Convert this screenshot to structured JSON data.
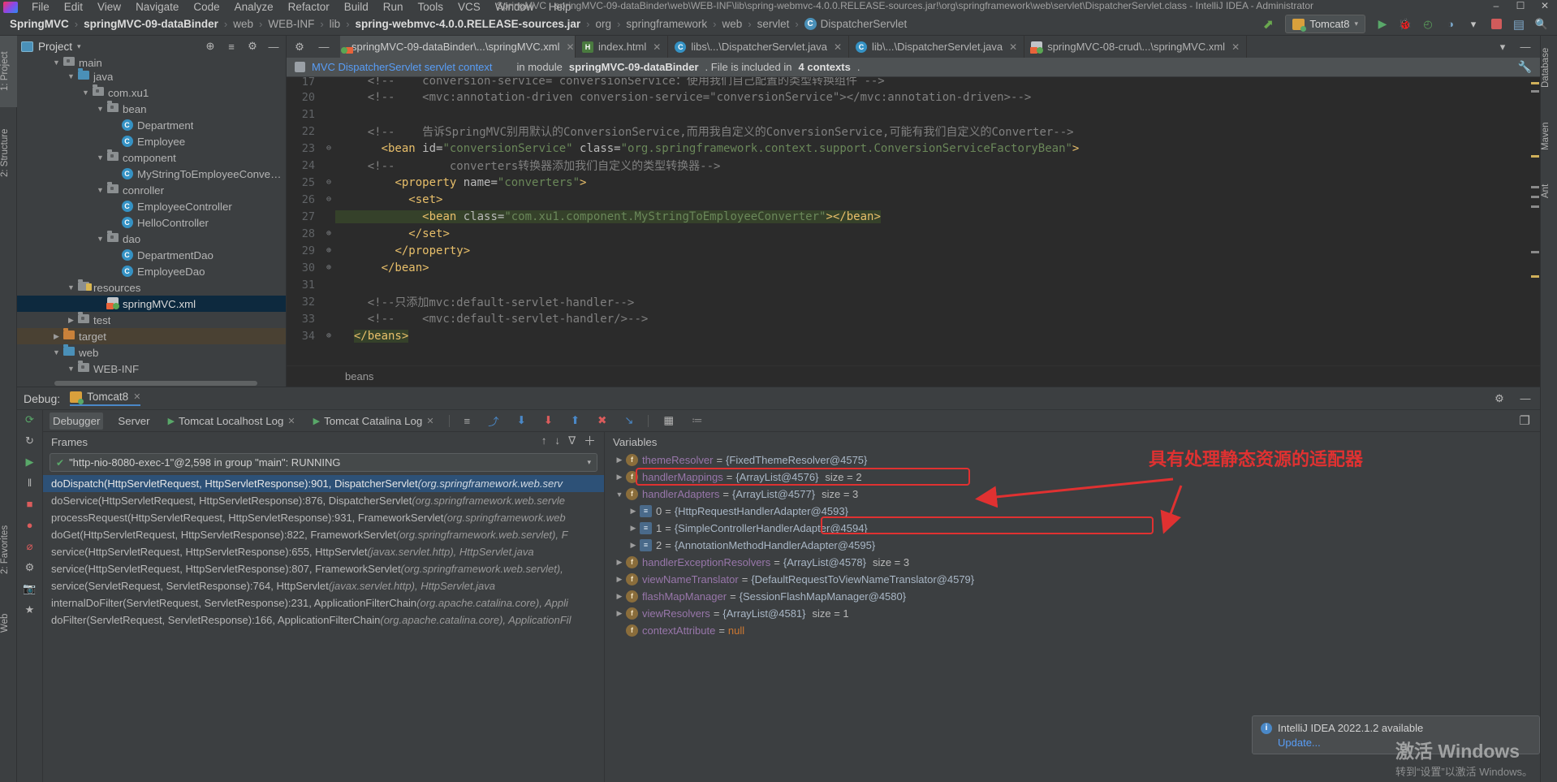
{
  "window": {
    "title": "SpringMVC - springMVC-09-dataBinder\\web\\WEB-INF\\lib\\spring-webmvc-4.0.0.RELEASE-sources.jar!\\org\\springframework\\web\\servlet\\DispatcherServlet.class - IntelliJ IDEA - Administrator",
    "minimize": "–",
    "maximize": "☐",
    "close": "✕"
  },
  "menu": {
    "items": [
      "File",
      "Edit",
      "View",
      "Navigate",
      "Code",
      "Analyze",
      "Refactor",
      "Build",
      "Run",
      "Tools",
      "VCS",
      "Window",
      "Help"
    ]
  },
  "breadcrumb": {
    "items": [
      {
        "label": "SpringMVC",
        "bold": true,
        "icon": ""
      },
      {
        "label": "springMVC-09-dataBinder",
        "bold": true,
        "icon": ""
      },
      {
        "label": "web",
        "bold": false,
        "icon": ""
      },
      {
        "label": "WEB-INF",
        "bold": false,
        "icon": ""
      },
      {
        "label": "lib",
        "bold": false,
        "icon": ""
      },
      {
        "label": "spring-webmvc-4.0.0.RELEASE-sources.jar",
        "bold": true,
        "icon": ""
      },
      {
        "label": "org",
        "bold": false,
        "icon": ""
      },
      {
        "label": "springframework",
        "bold": false,
        "icon": ""
      },
      {
        "label": "web",
        "bold": false,
        "icon": ""
      },
      {
        "label": "servlet",
        "bold": false,
        "icon": ""
      },
      {
        "label": "DispatcherServlet",
        "bold": false,
        "icon": "C"
      }
    ],
    "separator": "›"
  },
  "toolbar": {
    "build_icon": "⬈",
    "run_config": "Tomcat8",
    "run_icon": "▶",
    "debug_icon": "🐞",
    "coverage_icon": "◴",
    "profile_icon": "◑",
    "stop_icon": "■",
    "layout_icon": "▤",
    "search_icon": "🔍",
    "dropdown_caret": "▾"
  },
  "left_strip": {
    "items": [
      {
        "label": "1: Project",
        "active": true
      },
      {
        "label": "2: Structure",
        "active": false
      },
      {
        "label": "2: Favorites",
        "active": false
      },
      {
        "label": "Web",
        "active": false
      }
    ]
  },
  "right_strip": {
    "items": [
      {
        "label": "Database",
        "active": false
      },
      {
        "label": "Maven",
        "active": false
      },
      {
        "label": "Ant",
        "active": false
      }
    ]
  },
  "project_panel": {
    "title": "Project",
    "caret": "▾",
    "locate_icon": "⊕",
    "collapse_icon": "≡",
    "settings_icon": "⚙",
    "hide_icon": "—",
    "tree": [
      {
        "indent": 2,
        "arrow": "▼",
        "icon": "folder-grey",
        "label": "main",
        "sel": false,
        "clipped": true
      },
      {
        "indent": 3,
        "arrow": "▼",
        "icon": "folder-blue",
        "label": "java",
        "sel": false
      },
      {
        "indent": 4,
        "arrow": "▼",
        "icon": "folder-pkg",
        "label": "com.xu1",
        "sel": false
      },
      {
        "indent": 5,
        "arrow": "▼",
        "icon": "folder-pkg",
        "label": "bean",
        "sel": false
      },
      {
        "indent": 6,
        "arrow": "",
        "icon": "class",
        "label": "Department",
        "sel": false
      },
      {
        "indent": 6,
        "arrow": "",
        "icon": "class",
        "label": "Employee",
        "sel": false
      },
      {
        "indent": 5,
        "arrow": "▼",
        "icon": "folder-pkg",
        "label": "component",
        "sel": false
      },
      {
        "indent": 6,
        "arrow": "",
        "icon": "class",
        "label": "MyStringToEmployeeConverter",
        "sel": false
      },
      {
        "indent": 5,
        "arrow": "▼",
        "icon": "folder-pkg",
        "label": "conroller",
        "sel": false
      },
      {
        "indent": 6,
        "arrow": "",
        "icon": "class",
        "label": "EmployeeController",
        "sel": false
      },
      {
        "indent": 6,
        "arrow": "",
        "icon": "class",
        "label": "HelloController",
        "sel": false
      },
      {
        "indent": 5,
        "arrow": "▼",
        "icon": "folder-pkg",
        "label": "dao",
        "sel": false
      },
      {
        "indent": 6,
        "arrow": "",
        "icon": "class",
        "label": "DepartmentDao",
        "sel": false
      },
      {
        "indent": 6,
        "arrow": "",
        "icon": "class",
        "label": "EmployeeDao",
        "sel": false
      },
      {
        "indent": 3,
        "arrow": "▼",
        "icon": "folder-res",
        "label": "resources",
        "sel": false
      },
      {
        "indent": 5,
        "arrow": "",
        "icon": "xml",
        "label": "springMVC.xml",
        "sel": true
      },
      {
        "indent": 3,
        "arrow": "▶",
        "icon": "folder-grey",
        "label": "test",
        "sel": false
      },
      {
        "indent": 2,
        "arrow": "▶",
        "icon": "folder-target",
        "label": "target",
        "sel": false,
        "target": true
      },
      {
        "indent": 2,
        "arrow": "▼",
        "icon": "folder-blue",
        "label": "web",
        "sel": false
      },
      {
        "indent": 3,
        "arrow": "▼",
        "icon": "folder-grey",
        "label": "WEB-INF",
        "sel": false
      }
    ]
  },
  "editor": {
    "tabs": [
      {
        "label": "springMVC-09-dataBinder\\...\\springMVC.xml",
        "icon": "xml",
        "active": true,
        "close": "✕"
      },
      {
        "label": "index.html",
        "icon": "html",
        "active": false,
        "close": "✕"
      },
      {
        "label": "libs\\...\\DispatcherServlet.java",
        "icon": "class",
        "active": false,
        "close": "✕"
      },
      {
        "label": "lib\\...\\DispatcherServlet.java",
        "icon": "class",
        "active": false,
        "close": "✕"
      },
      {
        "label": "springMVC-08-crud\\...\\springMVC.xml",
        "icon": "xml",
        "active": false,
        "close": "✕"
      }
    ],
    "tab_overflow": "▾",
    "tab_pin": "—",
    "tab_settings": "⚙",
    "banner": {
      "link": "MVC DispatcherServlet servlet context",
      "rest_prefix": "in module ",
      "module": "springMVC-09-dataBinder",
      "rest_middle": ". File is included in ",
      "contexts": "4 contexts",
      "rest_suffix": ".",
      "wrench_icon": "🔧"
    },
    "lines": [
      {
        "no": "17",
        "fold": "",
        "clipped": true,
        "spans": [
          {
            "t": "    ",
            "c": "plain"
          },
          {
            "t": "<!--    conversion-service= conversionService：使用我们自己配置的类型转换组件 -->",
            "c": "comment"
          }
        ]
      },
      {
        "no": "20",
        "fold": "",
        "spans": [
          {
            "t": "    ",
            "c": "plain"
          },
          {
            "t": "<!--    <mvc:annotation-driven conversion-service=\"conversionService\"></mvc:annotation-driven>-->",
            "c": "comment"
          }
        ]
      },
      {
        "no": "21",
        "fold": "",
        "spans": []
      },
      {
        "no": "22",
        "fold": "",
        "spans": [
          {
            "t": "    ",
            "c": "plain"
          },
          {
            "t": "<!--    告诉SpringMVC别用默认的ConversionService,而用我自定义的ConversionService,可能有我们自定义的Converter-->",
            "c": "comment"
          }
        ]
      },
      {
        "no": "23",
        "fold": "⊖",
        "spans": [
          {
            "t": "      ",
            "c": "plain"
          },
          {
            "t": "<bean ",
            "c": "tag"
          },
          {
            "t": "id=",
            "c": "attr"
          },
          {
            "t": "\"conversionService\"",
            "c": "str"
          },
          {
            "t": " class=",
            "c": "attr"
          },
          {
            "t": "\"org.springframework.context.support.ConversionServiceFactoryBean\"",
            "c": "str"
          },
          {
            "t": ">",
            "c": "tag"
          }
        ]
      },
      {
        "no": "24",
        "fold": "",
        "spans": [
          {
            "t": "    ",
            "c": "plain"
          },
          {
            "t": "<!--        converters转换器添加我们自定义的类型转换器-->",
            "c": "comment"
          }
        ]
      },
      {
        "no": "25",
        "fold": "⊖",
        "spans": [
          {
            "t": "        ",
            "c": "plain"
          },
          {
            "t": "<property ",
            "c": "tag"
          },
          {
            "t": "name=",
            "c": "attr"
          },
          {
            "t": "\"converters\"",
            "c": "str"
          },
          {
            "t": ">",
            "c": "tag"
          }
        ]
      },
      {
        "no": "26",
        "fold": "⊖",
        "spans": [
          {
            "t": "          ",
            "c": "plain"
          },
          {
            "t": "<set>",
            "c": "tag"
          }
        ]
      },
      {
        "no": "27",
        "fold": "",
        "highlight": true,
        "spans": [
          {
            "t": "            ",
            "c": "plain"
          },
          {
            "t": "<bean ",
            "c": "tag"
          },
          {
            "t": "class=",
            "c": "attr"
          },
          {
            "t": "\"com.xu1.component.MyStringToEmployeeConverter\"",
            "c": "str"
          },
          {
            "t": "></bean>",
            "c": "tag"
          }
        ]
      },
      {
        "no": "28",
        "fold": "⊕",
        "spans": [
          {
            "t": "          ",
            "c": "plain"
          },
          {
            "t": "</set>",
            "c": "tag"
          }
        ]
      },
      {
        "no": "29",
        "fold": "⊕",
        "spans": [
          {
            "t": "        ",
            "c": "plain"
          },
          {
            "t": "</property>",
            "c": "tag"
          }
        ]
      },
      {
        "no": "30",
        "fold": "⊕",
        "spans": [
          {
            "t": "      ",
            "c": "plain"
          },
          {
            "t": "</bean>",
            "c": "tag"
          }
        ]
      },
      {
        "no": "31",
        "fold": "",
        "spans": []
      },
      {
        "no": "32",
        "fold": "",
        "spans": [
          {
            "t": "    ",
            "c": "plain"
          },
          {
            "t": "<!--只添加mvc:default-servlet-handler-->",
            "c": "comment"
          }
        ]
      },
      {
        "no": "33",
        "fold": "",
        "spans": [
          {
            "t": "    ",
            "c": "plain"
          },
          {
            "t": "<!--    <mvc:default-servlet-handler/>-->",
            "c": "comment"
          }
        ]
      },
      {
        "no": "34",
        "fold": "⊕",
        "spans": [
          {
            "t": "  ",
            "c": "plain"
          },
          {
            "t": "</beans>",
            "c": "tag-hl"
          }
        ]
      }
    ],
    "status_breadcrumb": "beans"
  },
  "debug": {
    "label": "Debug:",
    "session": "Tomcat8",
    "session_close": "✕",
    "settings_icon": "⚙",
    "hide_icon": "—",
    "rail": {
      "rerun_icon": "⟳",
      "refresh_icon": "↻",
      "resume_icon": "▶",
      "pause_icon": "‖",
      "stop_icon": "■",
      "breakpoints_icon": "●",
      "mute_icon": "⌀",
      "settings_icon": "⚙",
      "camera_icon": "📷",
      "star_icon": "★"
    },
    "subtabs": [
      {
        "label": "Debugger",
        "icon": "",
        "active": true,
        "close": ""
      },
      {
        "label": "Server",
        "icon": "",
        "active": false,
        "close": ""
      },
      {
        "label": "Tomcat Localhost Log",
        "icon": "▶",
        "active": false,
        "close": "✕"
      },
      {
        "label": "Tomcat Catalina Log",
        "icon": "▶",
        "active": false,
        "close": "✕"
      }
    ],
    "step_icons": [
      {
        "name": "show-execution-point-icon",
        "glyph": "≡",
        "color": "#b5b5b5"
      },
      {
        "name": "step-over-icon",
        "glyph": "⤴",
        "color": "#4a88c7"
      },
      {
        "name": "step-into-icon",
        "glyph": "⬇",
        "color": "#4a88c7"
      },
      {
        "name": "force-step-into-icon",
        "glyph": "⬇",
        "color": "#db5c5c"
      },
      {
        "name": "step-out-icon",
        "glyph": "⬆",
        "color": "#4a88c7"
      },
      {
        "name": "drop-frame-icon",
        "glyph": "✖",
        "color": "#db5c5c"
      },
      {
        "name": "run-to-cursor-icon",
        "glyph": "↘",
        "color": "#4a88c7"
      },
      {
        "name": "evaluate-expression-icon",
        "glyph": "▦",
        "color": "#b5b5b5"
      },
      {
        "name": "layout-settings-icon",
        "glyph": "≔",
        "color": "#8a8a8a"
      }
    ],
    "restore_layout_icon": "❐",
    "frames": {
      "label": "Frames",
      "thread": "\"http-nio-8080-exec-1\"@2,598 in group \"main\": RUNNING",
      "thread_check": "✔",
      "thread_caret": "▾",
      "toolbar": {
        "up_icon": "↑",
        "down_icon": "↓",
        "filter_icon": "∇",
        "add_icon": "＋"
      },
      "items": [
        {
          "method": "doDispatch(HttpServletRequest, HttpServletResponse):901, DispatcherServlet ",
          "origin": "(org.springframework.web.serv",
          "sel": true
        },
        {
          "method": "doService(HttpServletRequest, HttpServletResponse):876, DispatcherServlet ",
          "origin": "(org.springframework.web.servle",
          "sel": false
        },
        {
          "method": "processRequest(HttpServletRequest, HttpServletResponse):931, FrameworkServlet ",
          "origin": "(org.springframework.web",
          "sel": false
        },
        {
          "method": "doGet(HttpServletRequest, HttpServletResponse):822, FrameworkServlet ",
          "origin": "(org.springframework.web.servlet), F",
          "sel": false
        },
        {
          "method": "service(HttpServletRequest, HttpServletResponse):655, HttpServlet ",
          "origin": "(javax.servlet.http), HttpServlet.java",
          "sel": false
        },
        {
          "method": "service(HttpServletRequest, HttpServletResponse):807, FrameworkServlet ",
          "origin": "(org.springframework.web.servlet),",
          "sel": false
        },
        {
          "method": "service(ServletRequest, ServletResponse):764, HttpServlet ",
          "origin": "(javax.servlet.http), HttpServlet.java",
          "sel": false
        },
        {
          "method": "internalDoFilter(ServletRequest, ServletResponse):231, ApplicationFilterChain ",
          "origin": "(org.apache.catalina.core), Appli",
          "sel": false
        },
        {
          "method": "doFilter(ServletRequest, ServletResponse):166, ApplicationFilterChain ",
          "origin": "(org.apache.catalina.core), ApplicationFil",
          "sel": false
        }
      ]
    },
    "variables": {
      "label": "Variables",
      "items": [
        {
          "caret": "▶",
          "kind": "f",
          "name": "themeResolver",
          "value": "{FixedThemeResolver@4575}",
          "size": "",
          "indent": 0
        },
        {
          "caret": "▶",
          "kind": "f",
          "name": "handlerMappings",
          "value": "{ArrayList@4576}",
          "size": "size = 2",
          "indent": 0
        },
        {
          "caret": "▼",
          "kind": "f",
          "name": "handlerAdapters",
          "value": "{ArrayList@4577}",
          "size": "size = 3",
          "indent": 0,
          "boxed": true
        },
        {
          "caret": "▶",
          "kind": "i",
          "name": "0",
          "value": "{HttpRequestHandlerAdapter@4593}",
          "size": "",
          "indent": 1
        },
        {
          "caret": "▶",
          "kind": "i",
          "name": "1",
          "value": "{SimpleControllerHandlerAdapter@4594}",
          "size": "",
          "indent": 1
        },
        {
          "caret": "▶",
          "kind": "i",
          "name": "2",
          "value": "{AnnotationMethodHandlerAdapter@4595}",
          "size": "",
          "indent": 1,
          "boxed": true
        },
        {
          "caret": "▶",
          "kind": "f",
          "name": "handlerExceptionResolvers",
          "value": "{ArrayList@4578}",
          "size": "size = 3",
          "indent": 0
        },
        {
          "caret": "▶",
          "kind": "f",
          "name": "viewNameTranslator",
          "value": "{DefaultRequestToViewNameTranslator@4579}",
          "size": "",
          "indent": 0
        },
        {
          "caret": "▶",
          "kind": "f",
          "name": "flashMapManager",
          "value": "{SessionFlashMapManager@4580}",
          "size": "",
          "indent": 0
        },
        {
          "caret": "▶",
          "kind": "f",
          "name": "viewResolvers",
          "value": "{ArrayList@4581}",
          "size": "size = 1",
          "indent": 0
        },
        {
          "caret": "",
          "kind": "f",
          "name": "contextAttribute",
          "value": "null",
          "size": "",
          "indent": 0,
          "isnull": true
        }
      ]
    },
    "annotation": "具有处理静态资源的适配器"
  },
  "update_popup": {
    "badge": "i",
    "title": "IntelliJ IDEA 2022.1.2 available",
    "link": "Update..."
  },
  "watermark": {
    "line1": "激活 Windows",
    "line2": "转到“设置”以激活 Windows。"
  },
  "colors": {
    "accent_blue": "#4a88c7",
    "annotation_red": "#e03131",
    "selection_blue": "#2d5177",
    "tree_selection": "#0d293e",
    "highlight_green": "#35412a",
    "string_green": "#6a8759",
    "tag_yellow": "#e8bf6a",
    "comment_grey": "#808080",
    "field_orange": "#8a6d3b",
    "link_blue": "#589df6"
  }
}
